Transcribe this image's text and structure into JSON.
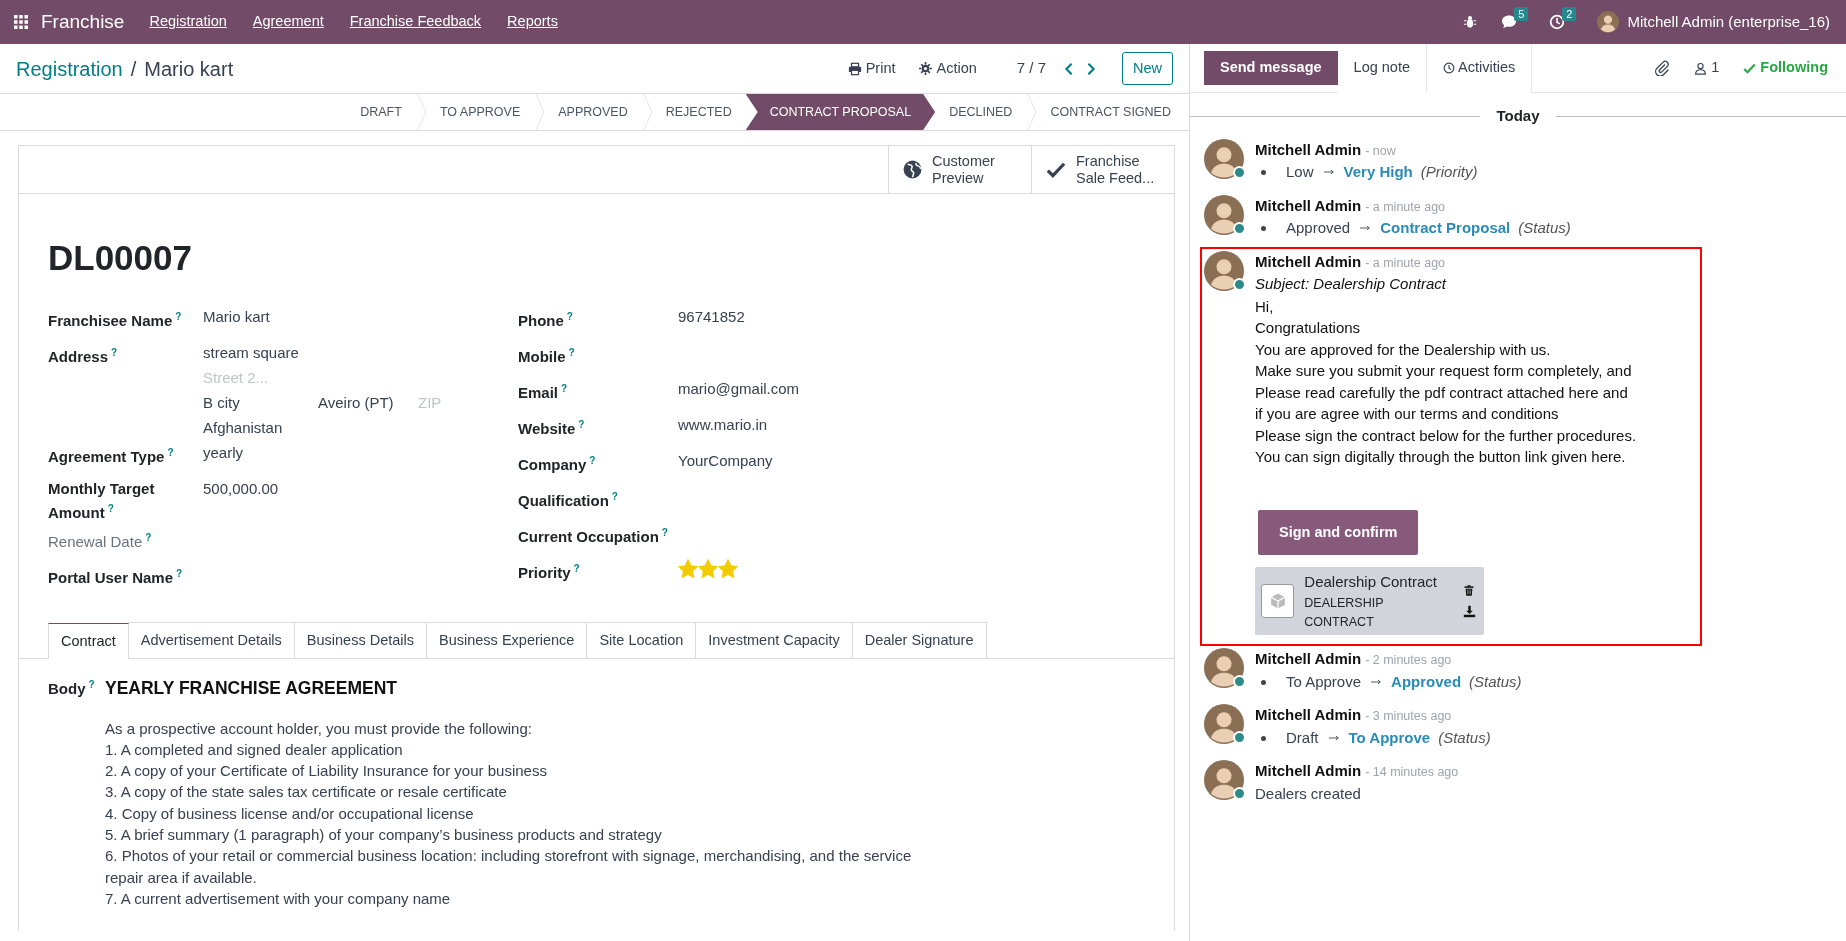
{
  "navbar": {
    "app_name": "Franchise",
    "menus": [
      "Registration",
      "Agreement",
      "Franchise Feedback",
      "Reports"
    ],
    "chat_count": "5",
    "activity_count": "2",
    "user": "Mitchell Admin (enterprise_16)"
  },
  "control_panel": {
    "breadcrumb": "Registration",
    "separator": "/",
    "record": "Mario kart",
    "print": "Print",
    "action": "Action",
    "pager": "7 / 7",
    "new": "New"
  },
  "stages": [
    {
      "label": "DRAFT",
      "selected": false
    },
    {
      "label": "TO APPROVE",
      "selected": false
    },
    {
      "label": "APPROVED",
      "selected": false
    },
    {
      "label": "REJECTED",
      "selected": false
    },
    {
      "label": "CONTRACT PROPOSAL",
      "selected": true
    },
    {
      "label": "DECLINED",
      "selected": false
    },
    {
      "label": "CONTRACT SIGNED",
      "selected": false
    }
  ],
  "smart_buttons": [
    {
      "kind": "globe",
      "lines": [
        "Customer",
        "Preview"
      ]
    },
    {
      "kind": "check",
      "lines": [
        "Franchise",
        "Sale Feed..."
      ]
    }
  ],
  "record_title": "DL00007",
  "fields_left": [
    {
      "label": "Franchisee Name",
      "help": "?",
      "kind": "text",
      "muted": false,
      "value": "Mario kart"
    },
    {
      "label": "Address",
      "help": "?",
      "kind": "address",
      "muted": false,
      "street": "stream square",
      "street2_placeholder": "Street 2...",
      "city": "B city",
      "state": "Aveiro (PT)",
      "zip_placeholder": "ZIP",
      "country": "Afghanistan"
    },
    {
      "label": "Agreement Type",
      "help": "?",
      "kind": "text",
      "muted": false,
      "value": "yearly"
    },
    {
      "label": "Monthly Target Amount",
      "help": "?",
      "kind": "text",
      "muted": false,
      "value": "500,000.00"
    },
    {
      "label": "Renewal Date",
      "help": "?",
      "kind": "text",
      "muted": true
    },
    {
      "label": "Portal User Name",
      "help": "?",
      "kind": "text",
      "muted": false
    }
  ],
  "fields_right": [
    {
      "label": "Phone",
      "help": "?",
      "kind": "text",
      "muted": false,
      "value": "96741852"
    },
    {
      "label": "Mobile",
      "help": "?",
      "kind": "text",
      "muted": false
    },
    {
      "label": "Email",
      "help": "?",
      "kind": "text",
      "muted": false,
      "value": "mario@gmail.com"
    },
    {
      "label": "Website",
      "help": "?",
      "kind": "text",
      "muted": false,
      "value": "www.mario.in"
    },
    {
      "label": "Company",
      "help": "?",
      "kind": "text",
      "muted": false,
      "value": "YourCompany"
    },
    {
      "label": "Qualification",
      "help": "?",
      "kind": "text",
      "muted": false
    },
    {
      "label": "Current Occupation",
      "help": "?",
      "kind": "text",
      "muted": false
    },
    {
      "label": "Priority",
      "help": "?",
      "kind": "stars",
      "muted": false,
      "stars": 3
    }
  ],
  "tabs": [
    {
      "label": "Contract",
      "selected": true
    },
    {
      "label": "Advertisement Details",
      "selected": false
    },
    {
      "label": "Business Details",
      "selected": false
    },
    {
      "label": "Business Experience",
      "selected": false
    },
    {
      "label": "Site Location",
      "selected": false
    },
    {
      "label": "Investment Capacity",
      "selected": false
    },
    {
      "label": "Dealer Signature",
      "selected": false
    }
  ],
  "body": {
    "label": "Body",
    "help": "?",
    "heading": "YEARLY FRANCHISE AGREEMENT",
    "lines": [
      "As a prospective account holder, you must provide the following:",
      "1. A completed and signed dealer application",
      "2. A copy of your Certificate of Liability Insurance for your business",
      "3. A copy of the state sales tax certificate or resale certificate",
      "4. Copy of business license and/or occupational license",
      "5. A brief summary (1 paragraph) of your company’s business products and strategy",
      "6. Photos of your retail or commercial business location: including storefront with signage, merchandising, and the service",
      "repair area if available.",
      "7. A current advertisement with your company name"
    ]
  },
  "chatter": {
    "tabs": [
      {
        "label": "Send message",
        "selected": true
      },
      {
        "label": "Log note",
        "selected": false
      },
      {
        "label": "Activities",
        "selected": false
      }
    ],
    "followers": "1",
    "following": "Following",
    "date_separator": "Today",
    "messages": [
      {
        "kind": "tracking",
        "author": "Mitchell Admin",
        "time": "- now",
        "highlighted": false,
        "old": "Low",
        "new": "Very High",
        "field": "(Priority)"
      },
      {
        "kind": "tracking",
        "author": "Mitchell Admin",
        "time": "- a minute ago",
        "highlighted": false,
        "old": "Approved",
        "new": "Contract Proposal",
        "field": "(Status)"
      },
      {
        "kind": "mail",
        "author": "Mitchell Admin",
        "time": "- a minute ago",
        "highlighted": true,
        "subject": "Subject: Dealership Contract",
        "lines": [
          "Hi,",
          "Congratulations",
          "You are approved for the Dealership with us.",
          "Make sure you submit your request form completely, and",
          "Please read carefully the pdf contract attached here and",
          "if you are agree with our terms and conditions",
          "Please sign the contract below for the further procedures.",
          "You can sign digitally through the button link given here."
        ],
        "button": "Sign and confirm",
        "attachment": {
          "name": "Dealership Contract",
          "type": "DEALERSHIP CONTRACT"
        }
      },
      {
        "kind": "tracking",
        "author": "Mitchell Admin",
        "time": "- 2 minutes ago",
        "highlighted": false,
        "old": "To Approve",
        "new": "Approved",
        "field": "(Status)"
      },
      {
        "kind": "tracking",
        "author": "Mitchell Admin",
        "time": "- 3 minutes ago",
        "highlighted": false,
        "old": "Draft",
        "new": "To Approve",
        "field": "(Status)"
      },
      {
        "kind": "note",
        "author": "Mitchell Admin",
        "time": "- 14 minutes ago",
        "highlighted": false,
        "body": "Dealers created"
      }
    ]
  }
}
